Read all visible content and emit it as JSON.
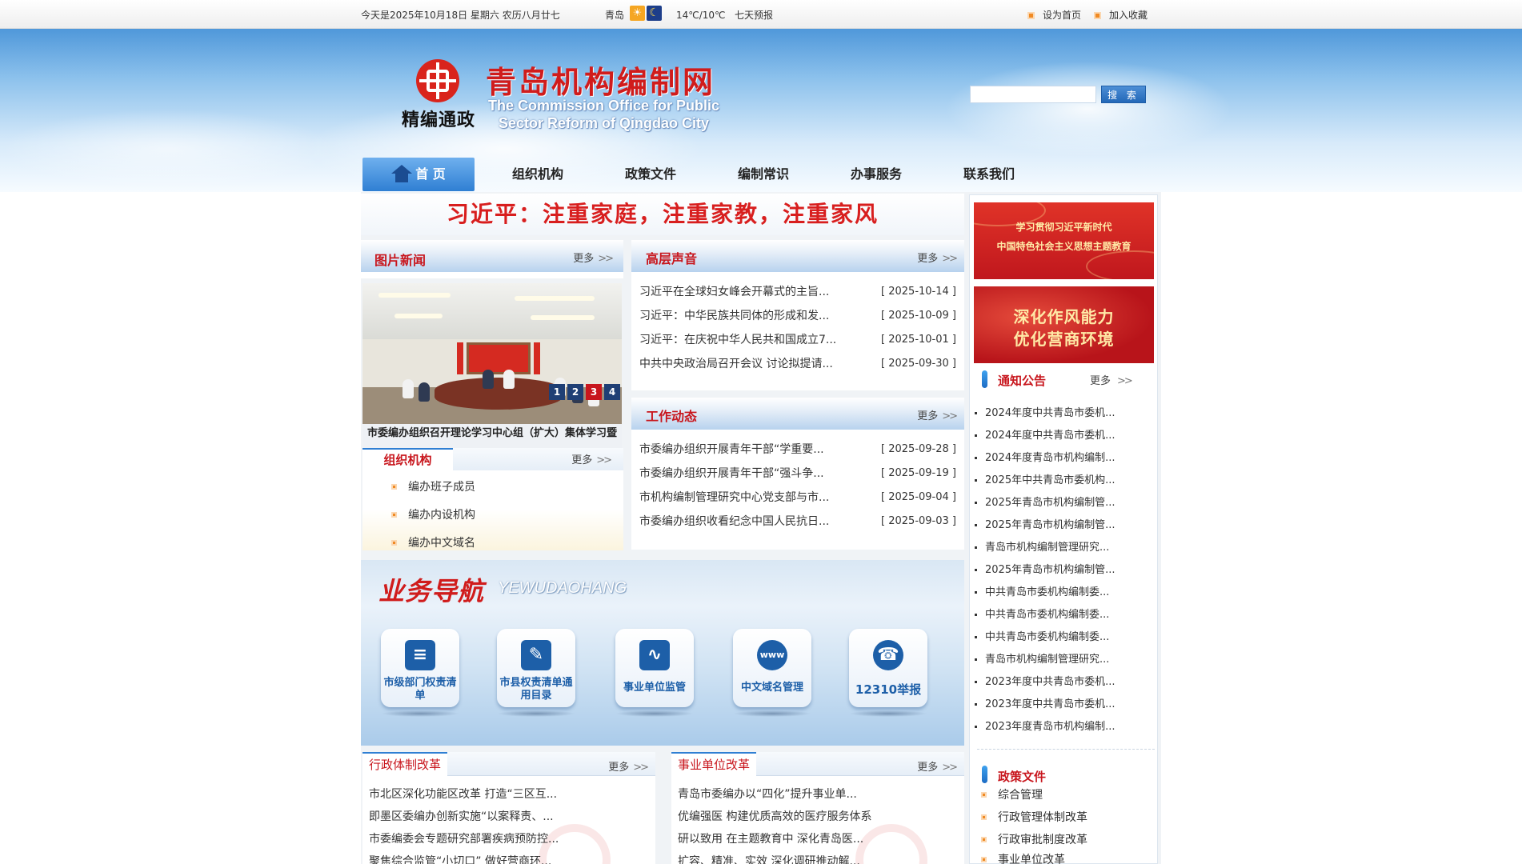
{
  "topbar": {
    "date": "今天是2025年10月18日 星期六 农历八月廿七",
    "city": "青岛",
    "weather_icons": [
      "sun-icon",
      "moon-icon"
    ],
    "temperature": "14℃/10℃",
    "forecast_link": "七天预报",
    "set_home": "设为首页",
    "add_favorite": "加入收藏"
  },
  "header": {
    "logo_slogan": "精编通政",
    "title": "青岛机构编制网",
    "subtitle_en_line1": "The Commission Office for Public",
    "subtitle_en_line2": "Sector Reform of Qingdao City",
    "search": {
      "placeholder": "",
      "button": "搜 索"
    }
  },
  "nav": {
    "items": [
      {
        "label": "首 页",
        "active": true
      },
      {
        "label": "组织机构"
      },
      {
        "label": "政策文件"
      },
      {
        "label": "编制常识"
      },
      {
        "label": "办事服务"
      },
      {
        "label": "联系我们"
      }
    ]
  },
  "slogan": "习近平：注重家庭，注重家教，注重家风",
  "more_label": "更多",
  "photo_news": {
    "title": "图片新闻",
    "caption": "市委编办组织召开理论学习中心组（扩大）集体学习暨",
    "pages": [
      "1",
      "2",
      "3",
      "4"
    ]
  },
  "high_level": {
    "title": "高层声音",
    "items": [
      {
        "title": "习近平在全球妇女峰会开幕式的主旨...",
        "date": "[ 2025-10-14 ]"
      },
      {
        "title": "习近平：中华民族共同体的形成和发...",
        "date": "[ 2025-10-09 ]"
      },
      {
        "title": "习近平：在庆祝中华人民共和国成立7...",
        "date": "[ 2025-10-01 ]"
      },
      {
        "title": "中共中央政治局召开会议 讨论拟提请...",
        "date": "[ 2025-09-30 ]"
      }
    ]
  },
  "work_news": {
    "title": "工作动态",
    "items": [
      {
        "title": "市委编办组织开展青年干部“学重要...",
        "date": "[ 2025-09-28 ]"
      },
      {
        "title": "市委编办组织开展青年干部“强斗争...",
        "date": "[ 2025-09-19 ]"
      },
      {
        "title": "市机构编制管理研究中心党支部与市...",
        "date": "[ 2025-09-04 ]"
      },
      {
        "title": "市委编办组织收看纪念中国人民抗日...",
        "date": "[ 2025-09-03 ]"
      }
    ]
  },
  "org": {
    "title": "组织机构",
    "items": [
      "编办班子成员",
      "编办内设机构",
      "编办中文域名"
    ]
  },
  "biz_nav": {
    "title": "业务导航",
    "subtitle": "YEWUDAOHANG",
    "cards": [
      {
        "label": "市级部门权责清单",
        "icon": "document-list-icon"
      },
      {
        "label": "市县权责清单通用目录",
        "icon": "edit-document-icon"
      },
      {
        "label": "事业单位监管",
        "icon": "pulse-monitor-icon"
      },
      {
        "label": "中文域名管理",
        "icon": "www-globe-icon"
      },
      {
        "label": "12310举报",
        "icon": "telephone-icon"
      }
    ]
  },
  "admin_reform": {
    "title": "行政体制改革",
    "items": [
      "市北区深化功能区改革 打造“三区互...",
      "即墨区委编办创新实施“以案释责、...",
      "市委编委会专题研究部署疾病预防控...",
      "聚焦综合监管“小切口” 做好营商环..."
    ]
  },
  "unit_reform": {
    "title": "事业单位改革",
    "items": [
      "青岛市委编办以“四化”提升事业单...",
      "优编强医 构建优质高效的医疗服务体系",
      "研以致用 在主题教育中 深化青岛医...",
      "扩容、精准、实效 深化调研推动解..."
    ]
  },
  "sidebar": {
    "promo1_line1": "学习贯彻习近平新时代",
    "promo1_line2": "中国特色社会主义思想主题教育",
    "promo2_line1": "深化作风能力",
    "promo2_line2": "优化营商环境",
    "notice_title": "通知公告",
    "notices": [
      "2024年度中共青岛市委机...",
      "2024年度中共青岛市委机...",
      "2024年度青岛市机构编制...",
      "2025年中共青岛市委机构...",
      "2025年青岛市机构编制管...",
      "2025年青岛市机构编制管...",
      "青岛市机构编制管理研究...",
      "2025年青岛市机构编制管...",
      "中共青岛市委机构编制委...",
      "中共青岛市委机构编制委...",
      "中共青岛市委机构编制委...",
      "青岛市机构编制管理研究...",
      "2023年度中共青岛市委机...",
      "2023年度中共青岛市委机...",
      "2023年度青岛市机构编制..."
    ],
    "policy_title": "政策文件",
    "policies": [
      "综合管理",
      "行政管理体制改革",
      "行政审批制度改革",
      "事业单位改革"
    ]
  },
  "colors": {
    "accent_red": "#c8161d",
    "nav_blue": "#2f7fd3",
    "bullet_orange": "#f08a24"
  }
}
